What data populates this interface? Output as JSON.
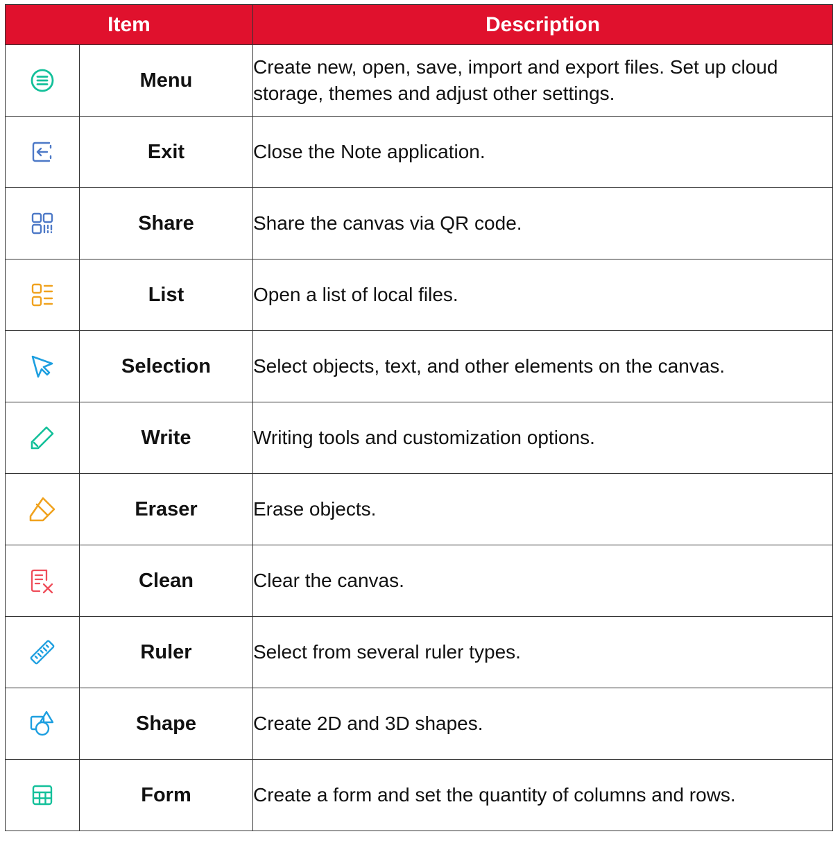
{
  "header": {
    "item": "Item",
    "description": "Description"
  },
  "rows": [
    {
      "icon": "menu-icon",
      "color": "#13c09a",
      "name": "Menu",
      "description": "Create new, open, save, import and export files. Set up cloud storage, themes and adjust other settings."
    },
    {
      "icon": "exit-icon",
      "color": "#4d79c7",
      "name": "Exit",
      "description": "Close the Note application."
    },
    {
      "icon": "share-qr-icon",
      "color": "#4d79c7",
      "name": "Share",
      "description": "Share the canvas via QR code."
    },
    {
      "icon": "list-icon",
      "color": "#f0a21e",
      "name": "List",
      "description": "Open a list of local files."
    },
    {
      "icon": "cursor-icon",
      "color": "#1d9fe0",
      "name": "Selection",
      "description": "Select objects, text, and other elements on the canvas."
    },
    {
      "icon": "pen-icon",
      "color": "#13c09a",
      "name": "Write",
      "description": "Writing tools and customization options."
    },
    {
      "icon": "eraser-icon",
      "color": "#f0a21e",
      "name": "Eraser",
      "description": "Erase objects."
    },
    {
      "icon": "clean-icon",
      "color": "#ef4d5a",
      "name": "Clean",
      "description": "Clear the canvas."
    },
    {
      "icon": "ruler-icon",
      "color": "#1d9fe0",
      "name": "Ruler",
      "description": "Select from several ruler types."
    },
    {
      "icon": "shape-icon",
      "color": "#1d9fe0",
      "name": "Shape",
      "description": "Create 2D and 3D shapes."
    },
    {
      "icon": "form-icon",
      "color": "#13c09a",
      "name": "Form",
      "description": "Create a form and set the quantity of columns and rows."
    }
  ],
  "colors": {
    "header_background": "#e0112d",
    "header_text": "#ffffff",
    "border": "#333333"
  }
}
